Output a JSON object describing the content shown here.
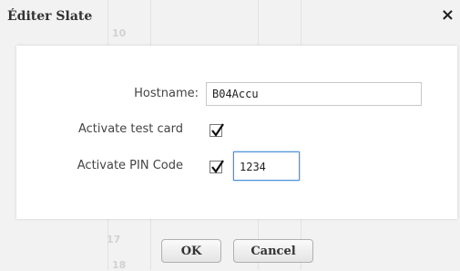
{
  "dialog": {
    "title": "Éditer Slate",
    "close_glyph": "×"
  },
  "background": {
    "numbers": [
      "10",
      "17",
      "18"
    ]
  },
  "form": {
    "hostname_label": "Hostname:",
    "hostname_value": "B04Accu",
    "test_card_label": "Activate test card",
    "test_card_checked": true,
    "pin_label": "Activate PIN Code",
    "pin_checked": true,
    "pin_value": "1234"
  },
  "buttons": {
    "ok_label": "OK",
    "cancel_label": "Cancel"
  },
  "colors": {
    "focus_border": "#4a90d9",
    "panel_bg": "#ffffff",
    "page_bg": "#f2f2f2"
  }
}
